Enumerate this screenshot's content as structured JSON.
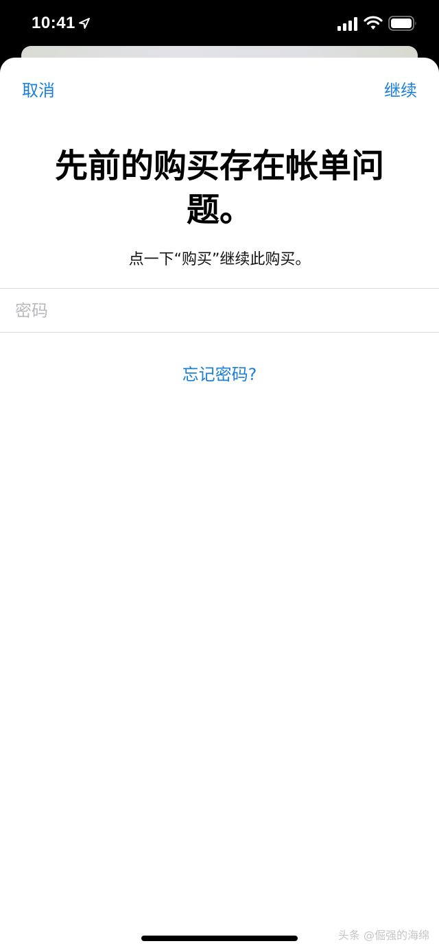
{
  "status_bar": {
    "time": "10:41",
    "icons": [
      "location-arrow-icon",
      "cellular-signal-icon",
      "wifi-icon",
      "battery-icon"
    ]
  },
  "nav": {
    "cancel_label": "取消",
    "continue_label": "继续"
  },
  "content": {
    "title": "先前的购买存在帐单问题。",
    "subtitle": "点一下“购买”继续此购买。",
    "password_placeholder": "密码",
    "password_value": "",
    "forgot_link": "忘记密码?"
  },
  "watermark": "头条 @倔强的海绵",
  "colors": {
    "accent": "#1a7fd6",
    "placeholder": "#b8b8bd",
    "divider": "#d8d8dc",
    "background": "#ffffff",
    "status_bar_bg": "#000000"
  }
}
